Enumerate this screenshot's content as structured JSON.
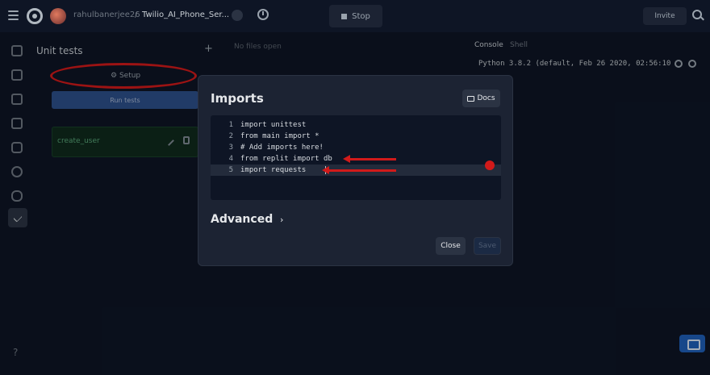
{
  "topbar": {
    "username": "rahulbanerjee26",
    "separator": "/",
    "repo_name": "Twilio_AI_Phone_Ser...",
    "stop_label": "Stop",
    "invite_label": "Invite"
  },
  "unit_tests": {
    "title": "Unit tests",
    "add_symbol": "+",
    "setup_label": "Setup",
    "run_tests_label": "Run tests",
    "tests": [
      {
        "name": "create_user"
      }
    ]
  },
  "editor": {
    "empty_label": "No files open"
  },
  "console": {
    "tabs": [
      "Console",
      "Shell"
    ],
    "output": "Python 3.8.2 (default, Feb 26 2020, 02:56:10"
  },
  "modal": {
    "title": "Imports",
    "docs_label": "Docs",
    "code_lines": [
      {
        "num": "1",
        "text": "import unittest"
      },
      {
        "num": "2",
        "text": "from main import *"
      },
      {
        "num": "3",
        "text": "# Add imports here!"
      },
      {
        "num": "4",
        "text": "from replit import db"
      },
      {
        "num": "5",
        "text": "import requests"
      }
    ],
    "advanced_label": "Advanced",
    "advanced_chevron": "›",
    "close_label": "Close",
    "save_label": "Save"
  },
  "rail": {
    "help_label": "?"
  },
  "colors": {
    "accent_annotation": "#d11a1a",
    "run_tests_button": "#2d4f8a",
    "test_row_bg": "#0f2a1d"
  }
}
